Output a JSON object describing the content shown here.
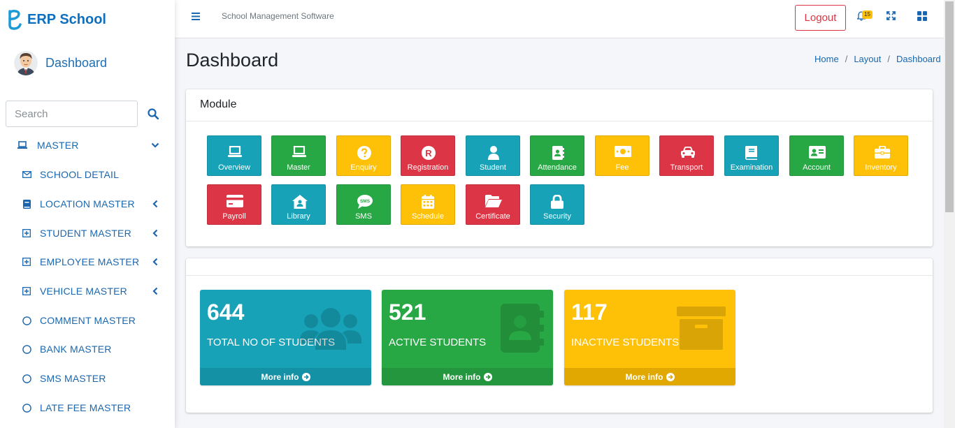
{
  "brand": {
    "name": "ERP School"
  },
  "user": {
    "name": "Dashboard"
  },
  "search": {
    "placeholder": "Search"
  },
  "sidebar": {
    "items": [
      {
        "label": "MASTER",
        "icon": "laptop-icon"
      },
      {
        "label": "SCHOOL DETAIL",
        "icon": "envelope-icon"
      },
      {
        "label": "LOCATION MASTER",
        "icon": "book-icon"
      },
      {
        "label": "STUDENT MASTER",
        "icon": "plus-square-icon"
      },
      {
        "label": "EMPLOYEE MASTER",
        "icon": "plus-square-icon"
      },
      {
        "label": "VEHICLE MASTER",
        "icon": "plus-square-icon"
      },
      {
        "label": "COMMENT MASTER",
        "icon": "circle-icon"
      },
      {
        "label": "BANK MASTER",
        "icon": "circle-icon"
      },
      {
        "label": "SMS MASTER",
        "icon": "circle-icon"
      },
      {
        "label": "LATE FEE MASTER",
        "icon": "circle-icon"
      }
    ]
  },
  "topbar": {
    "app_title": "School Management Software",
    "logout_label": "Logout",
    "notification_count": "15"
  },
  "page": {
    "title": "Dashboard",
    "breadcrumb": [
      "Home",
      "Layout",
      "Dashboard"
    ]
  },
  "module": {
    "title": "Module",
    "tiles": [
      {
        "label": "Overview",
        "color": "#17a2b8",
        "icon": "laptop-icon"
      },
      {
        "label": "Master",
        "color": "#28a745",
        "icon": "laptop-icon"
      },
      {
        "label": "Enquiry",
        "color": "#ffc107",
        "icon": "question-circle-icon"
      },
      {
        "label": "Registration",
        "color": "#dc3545",
        "icon": "registered-icon"
      },
      {
        "label": "Student",
        "color": "#17a2b8",
        "icon": "user-icon"
      },
      {
        "label": "Attendance",
        "color": "#28a745",
        "icon": "address-book-icon"
      },
      {
        "label": "Fee",
        "color": "#ffc107",
        "icon": "money-bill-icon"
      },
      {
        "label": "Transport",
        "color": "#dc3545",
        "icon": "car-icon"
      },
      {
        "label": "Examination",
        "color": "#17a2b8",
        "icon": "book-icon"
      },
      {
        "label": "Account",
        "color": "#28a745",
        "icon": "id-card-icon"
      },
      {
        "label": "Inventory",
        "color": "#ffc107",
        "icon": "briefcase-icon"
      },
      {
        "label": "Payroll",
        "color": "#dc3545",
        "icon": "credit-card-icon"
      },
      {
        "label": "Library",
        "color": "#17a2b8",
        "icon": "house-user-icon"
      },
      {
        "label": "SMS",
        "color": "#28a745",
        "icon": "sms-icon"
      },
      {
        "label": "Schedule",
        "color": "#ffc107",
        "icon": "calendar-icon"
      },
      {
        "label": "Certificate",
        "color": "#dc3545",
        "icon": "folder-open-icon"
      },
      {
        "label": "Security",
        "color": "#17a2b8",
        "icon": "lock-icon"
      }
    ]
  },
  "stats": [
    {
      "value": "644",
      "label": "TOTAL NO OF STUDENTS",
      "more": "More info",
      "color": "#17a2b8",
      "icon": "users-icon"
    },
    {
      "value": "521",
      "label": "ACTIVE STUDENTS",
      "more": "More info",
      "color": "#28a745",
      "icon": "address-book-icon"
    },
    {
      "value": "117",
      "label": "INACTIVE STUDENTS",
      "more": "More info",
      "color": "#ffc107",
      "icon": "archive-icon"
    }
  ]
}
